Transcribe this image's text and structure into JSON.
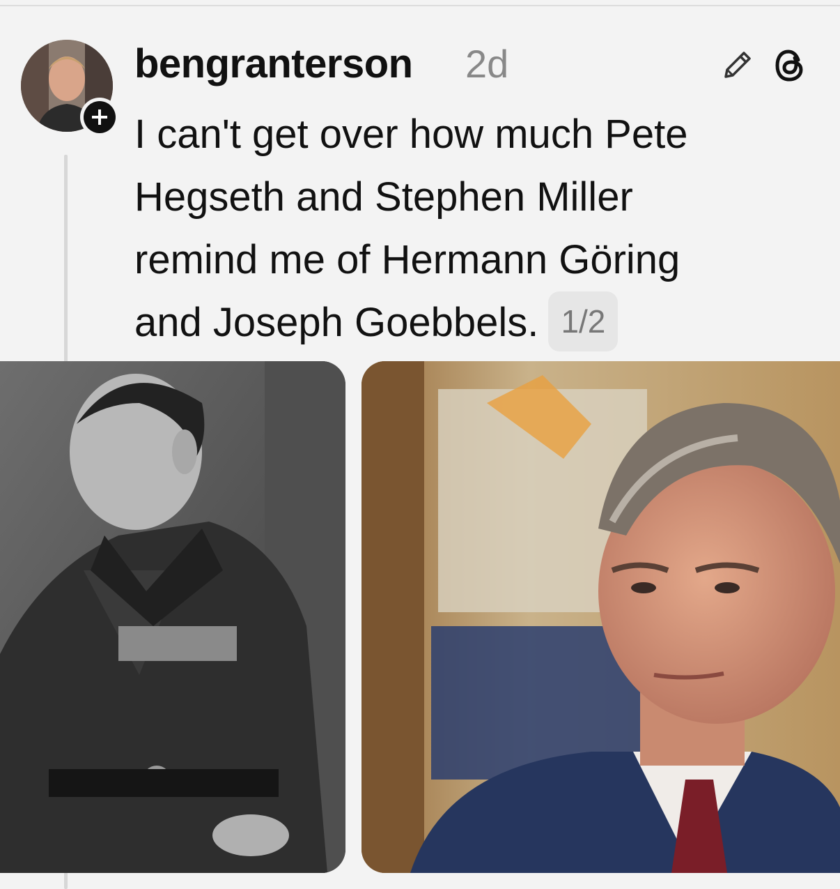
{
  "post": {
    "username": "bengranterson",
    "timestamp": "2d",
    "text_lines": [
      "I can't get over how much Pete",
      "Hegseth and Stephen Miller",
      "remind me of Hermann Göring",
      "and Joseph Goebbels."
    ],
    "counter": "1/2"
  },
  "icons": {
    "follow": "plus-icon",
    "edit": "pencil-icon",
    "app": "threads-logo-icon"
  },
  "colors": {
    "background": "#f3f3f3",
    "text": "#111111",
    "muted": "#888888",
    "counter_bg": "#e6e6e6"
  }
}
